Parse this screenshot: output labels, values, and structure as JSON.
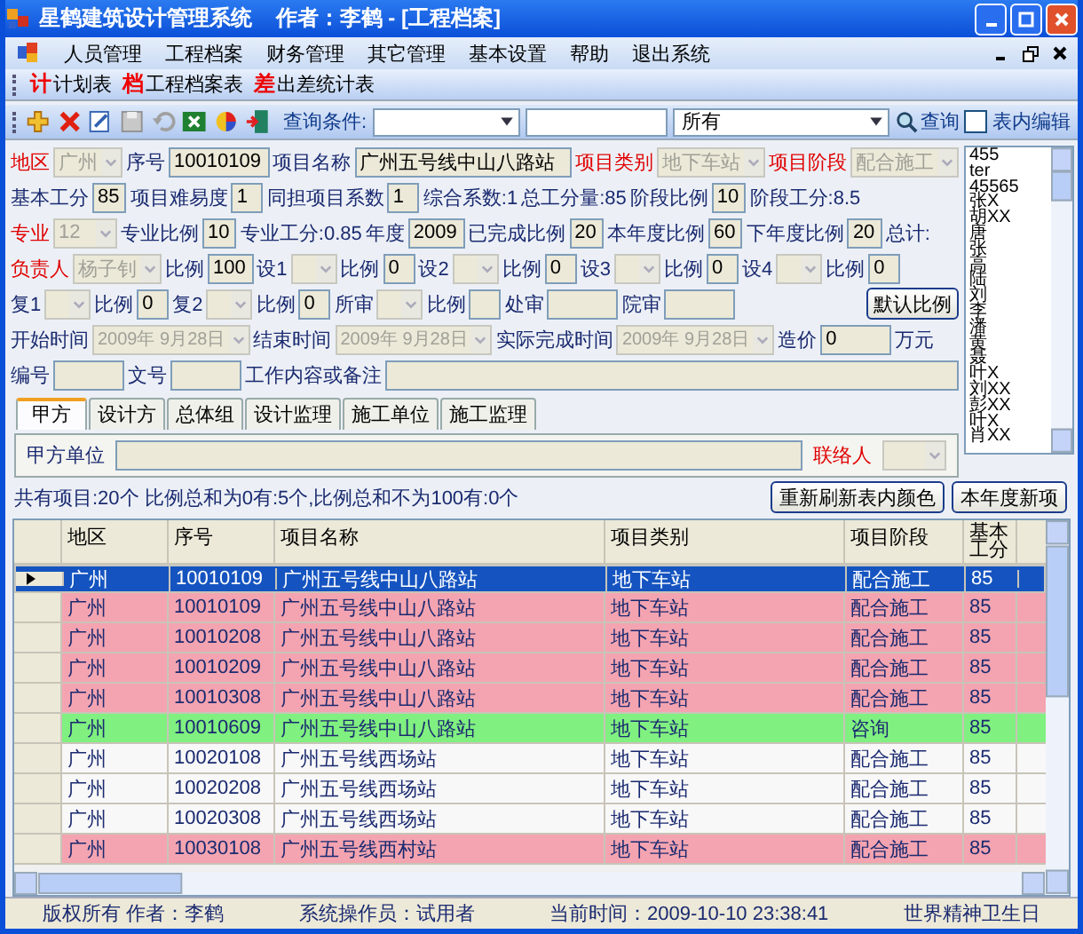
{
  "window": {
    "title": "星鹤建筑设计管理系统    作者：李鹤 - [工程档案]"
  },
  "menu": [
    "人员管理",
    "工程档案",
    "财务管理",
    "其它管理",
    "基本设置",
    "帮助",
    "退出系统"
  ],
  "report_toolbar": [
    {
      "icon": "计",
      "label": "计划表"
    },
    {
      "icon": "档",
      "label": "工程档案表"
    },
    {
      "icon": "差",
      "label": "出差统计表"
    }
  ],
  "query_bar": {
    "label": "查询条件:",
    "scope": "所有",
    "search_button": "查询",
    "table_edit": {
      "label": "表内编辑",
      "checked": false
    }
  },
  "form": {
    "rows": [
      {
        "items": [
          {
            "kind": "label",
            "text": "地区",
            "red": true
          },
          {
            "kind": "combo",
            "value": "广州"
          },
          {
            "kind": "label",
            "text": "序号",
            "red": false
          },
          {
            "kind": "input",
            "value": "10010109"
          },
          {
            "kind": "label",
            "text": "项目名称",
            "red": false
          },
          {
            "kind": "grow",
            "value": "广州五号线中山八路站"
          },
          {
            "kind": "label",
            "text": "项目类别",
            "red": true
          },
          {
            "kind": "combo",
            "value": "地下车站"
          },
          {
            "kind": "label",
            "text": "项目阶段",
            "red": true
          },
          {
            "kind": "combo",
            "value": "配合施工"
          }
        ]
      },
      {
        "items": [
          {
            "kind": "label",
            "text": "基本工分",
            "red": false
          },
          {
            "kind": "num",
            "value": "85"
          },
          {
            "kind": "label",
            "text": "项目难易度",
            "red": false
          },
          {
            "kind": "num",
            "value": "1"
          },
          {
            "kind": "label",
            "text": "同担项目系数",
            "red": false
          },
          {
            "kind": "num",
            "value": "1"
          },
          {
            "kind": "label",
            "text": "综合系数:1",
            "red": false
          },
          {
            "kind": "label",
            "text": "总工分量:85",
            "red": false
          },
          {
            "kind": "label",
            "text": "阶段比例",
            "red": false
          },
          {
            "kind": "num",
            "value": "10"
          },
          {
            "kind": "label",
            "text": "阶段工分:8.5",
            "red": false
          }
        ]
      },
      {
        "items": [
          {
            "kind": "label",
            "text": "专业",
            "red": true
          },
          {
            "kind": "combo",
            "value": "12"
          },
          {
            "kind": "label",
            "text": "专业比例",
            "red": false
          },
          {
            "kind": "num",
            "value": "10"
          },
          {
            "kind": "label",
            "text": "专业工分:0.85",
            "red": false
          },
          {
            "kind": "label",
            "text": "年度",
            "red": false
          },
          {
            "kind": "num",
            "value": "2009"
          },
          {
            "kind": "label",
            "text": "已完成比例",
            "red": false
          },
          {
            "kind": "num",
            "value": "20"
          },
          {
            "kind": "label",
            "text": "本年度比例",
            "red": false
          },
          {
            "kind": "num",
            "value": "60"
          },
          {
            "kind": "label",
            "text": "下年度比例",
            "red": false
          },
          {
            "kind": "num",
            "value": "20"
          },
          {
            "kind": "label",
            "text": "总计:",
            "red": false
          }
        ]
      },
      {
        "items": [
          {
            "kind": "label",
            "text": "负责人",
            "red": true
          },
          {
            "kind": "combo",
            "value": "杨子钊"
          },
          {
            "kind": "label",
            "text": "比例",
            "red": false
          },
          {
            "kind": "num",
            "value": "100"
          },
          {
            "kind": "label",
            "text": "设1",
            "red": false
          },
          {
            "kind": "select"
          },
          {
            "kind": "label",
            "text": "比例",
            "red": false
          },
          {
            "kind": "num",
            "value": "0"
          },
          {
            "kind": "label",
            "text": "设2",
            "red": false
          },
          {
            "kind": "select"
          },
          {
            "kind": "label",
            "text": "比例",
            "red": false
          },
          {
            "kind": "num",
            "value": "0"
          },
          {
            "kind": "label",
            "text": "设3",
            "red": false
          },
          {
            "kind": "select"
          },
          {
            "kind": "label",
            "text": "比例",
            "red": false
          },
          {
            "kind": "num",
            "value": "0"
          },
          {
            "kind": "label",
            "text": "设4",
            "red": false
          },
          {
            "kind": "select"
          },
          {
            "kind": "label",
            "text": "比例",
            "red": false
          },
          {
            "kind": "num",
            "value": "0"
          }
        ]
      },
      {
        "items": [
          {
            "kind": "label",
            "text": "复1",
            "red": false
          },
          {
            "kind": "select"
          },
          {
            "kind": "label",
            "text": "比例",
            "red": false
          },
          {
            "kind": "num",
            "value": "0"
          },
          {
            "kind": "label",
            "text": "复2",
            "red": false
          },
          {
            "kind": "select"
          },
          {
            "kind": "label",
            "text": "比例",
            "red": false
          },
          {
            "kind": "num",
            "value": "0"
          },
          {
            "kind": "label",
            "text": "所审",
            "red": false
          },
          {
            "kind": "select"
          },
          {
            "kind": "label",
            "text": "比例",
            "red": false
          },
          {
            "kind": "num"
          },
          {
            "kind": "label",
            "text": "处审",
            "red": false
          },
          {
            "kind": "input"
          },
          {
            "kind": "label",
            "text": "院审",
            "red": false
          },
          {
            "kind": "input"
          },
          {
            "kind": "button",
            "text": "默认比例"
          }
        ]
      },
      {
        "items": [
          {
            "kind": "label",
            "text": "开始时间",
            "red": false
          },
          {
            "kind": "date",
            "value": "2009年 9月28日"
          },
          {
            "kind": "label",
            "text": "结束时间",
            "red": false
          },
          {
            "kind": "date",
            "value": "2009年 9月28日"
          },
          {
            "kind": "label",
            "text": "实际完成时间",
            "red": false
          },
          {
            "kind": "date",
            "value": "2009年 9月28日"
          },
          {
            "kind": "label",
            "text": "造价",
            "red": false
          },
          {
            "kind": "input",
            "value": "0"
          },
          {
            "kind": "label",
            "text": "万元",
            "red": false
          }
        ]
      },
      {
        "items": [
          {
            "kind": "label",
            "text": "编号",
            "red": false
          },
          {
            "kind": "input"
          },
          {
            "kind": "label",
            "text": "文号",
            "red": false
          },
          {
            "kind": "input"
          },
          {
            "kind": "label",
            "text": "工作内容或备注",
            "red": false
          },
          {
            "kind": "grow"
          }
        ]
      }
    ],
    "people": [
      "455",
      "ter",
      "45565",
      "张X",
      "胡XX",
      "唐",
      "张",
      "高",
      "陆",
      "刘",
      "李",
      "潘",
      "黄",
      "聂",
      "叶X",
      "刘XX",
      "彭XX",
      "叶X",
      "肖XX"
    ]
  },
  "tabs": [
    {
      "label": "甲方",
      "selected": true
    },
    {
      "label": "设计方",
      "selected": false
    },
    {
      "label": "总体组",
      "selected": false
    },
    {
      "label": "设计监理",
      "selected": false
    },
    {
      "label": "施工单位",
      "selected": false
    },
    {
      "label": "施工监理",
      "selected": false
    }
  ],
  "tab_panel": {
    "unit_label": "甲方单位",
    "contact_label": "联络人"
  },
  "summary": "共有项目:20个 比例总和为0有:5个,比例总和不为100有:0个",
  "action_buttons": [
    "重新刷新表内颜色",
    "本年度新项"
  ],
  "table": {
    "columns": [
      "地区",
      "序号",
      "项目名称",
      "项目类别",
      "项目阶段",
      "基本工分"
    ],
    "rows": [
      {
        "cells": [
          "广州",
          "10010109",
          "广州五号线中山八路站",
          "地下车站",
          "配合施工",
          "85"
        ],
        "selected": true
      },
      {
        "cells": [
          "广州",
          "10010109",
          "广州五号线中山八路站",
          "地下车站",
          "配合施工",
          "85"
        ],
        "selected": false,
        "color": "#f4a4b0"
      },
      {
        "cells": [
          "广州",
          "10010208",
          "广州五号线中山八路站",
          "地下车站",
          "配合施工",
          "85"
        ],
        "selected": false,
        "color": "#f4a4b0"
      },
      {
        "cells": [
          "广州",
          "10010209",
          "广州五号线中山八路站",
          "地下车站",
          "配合施工",
          "85"
        ],
        "selected": false,
        "color": "#f4a4b0"
      },
      {
        "cells": [
          "广州",
          "10010308",
          "广州五号线中山八路站",
          "地下车站",
          "配合施工",
          "85"
        ],
        "selected": false,
        "color": "#f4a4b0"
      },
      {
        "cells": [
          "广州",
          "10010609",
          "广州五号线中山八路站",
          "地下车站",
          "咨询",
          "85"
        ],
        "selected": false,
        "color": "#80f080"
      },
      {
        "cells": [
          "广州",
          "10020108",
          "广州五号线西场站",
          "地下车站",
          "配合施工",
          "85"
        ],
        "selected": false,
        "color": "#f8f8f8"
      },
      {
        "cells": [
          "广州",
          "10020208",
          "广州五号线西场站",
          "地下车站",
          "配合施工",
          "85"
        ],
        "selected": false,
        "color": "#f8f8f8"
      },
      {
        "cells": [
          "广州",
          "10020308",
          "广州五号线西场站",
          "地下车站",
          "配合施工",
          "85"
        ],
        "selected": false,
        "color": "#f8f8f8"
      },
      {
        "cells": [
          "广州",
          "10030108",
          "广州五号线西村站",
          "地下车站",
          "配合施工",
          "85"
        ],
        "selected": false,
        "color": "#f4a4b0"
      }
    ]
  },
  "status_bar": [
    "版权所有 作者：李鹤",
    "系统操作员：试用者",
    "当前时间：2009-10-10 23:38:41",
    "世界精神卫生日"
  ]
}
